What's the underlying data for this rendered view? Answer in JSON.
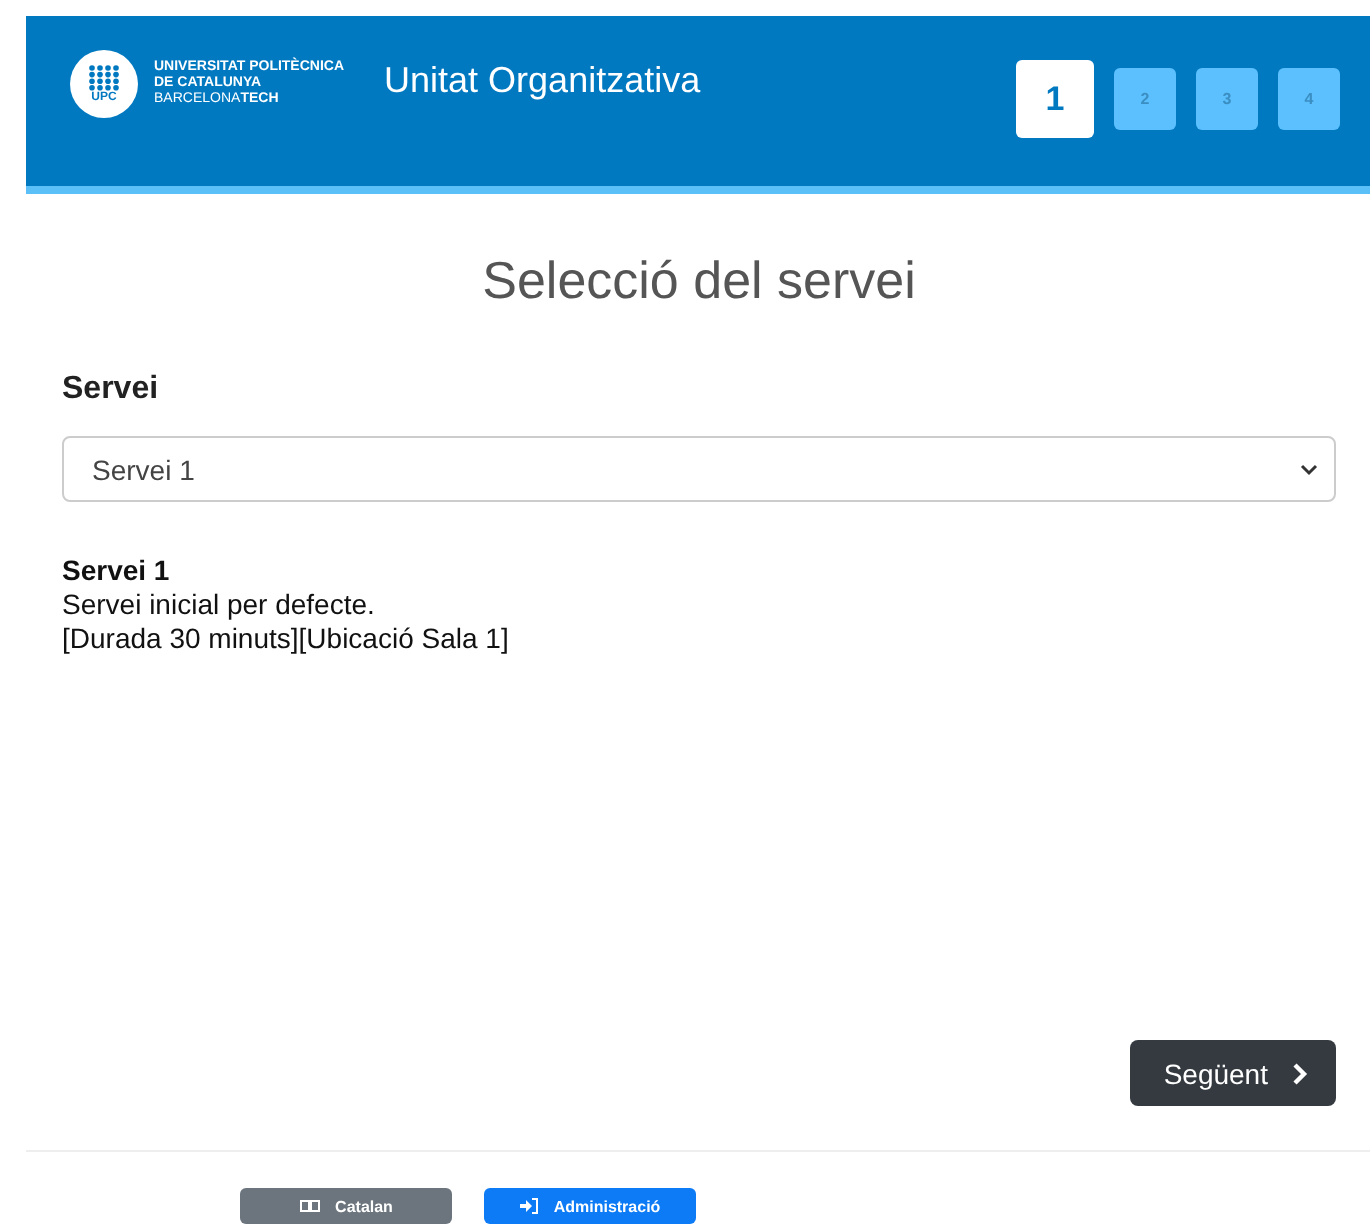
{
  "header": {
    "logo": {
      "badge": "UPC",
      "lines": [
        "UNIVERSITAT POLITÈCNICA",
        "DE CATALUNYA"
      ],
      "last_line": {
        "light": "BARCELONA",
        "bold": "TECH"
      }
    },
    "title": "Unitat Organitzativa",
    "steps": [
      {
        "label": "1",
        "selected": true
      },
      {
        "label": "2",
        "selected": false
      },
      {
        "label": "3",
        "selected": false
      },
      {
        "label": "4",
        "selected": false
      }
    ]
  },
  "heading": "Selecció del servei",
  "service": {
    "label": "Servei",
    "value": "Servei 1"
  },
  "description": {
    "name": "Servei 1",
    "text": "Servei inicial per defecte.",
    "details": "[Durada 30 minuts][Ubicació Sala 1]"
  },
  "next_button": "Següent",
  "footer": {
    "buttons": [
      {
        "kind": "language",
        "label": "Catalan"
      },
      {
        "kind": "admin",
        "label": "Administració"
      }
    ]
  }
}
